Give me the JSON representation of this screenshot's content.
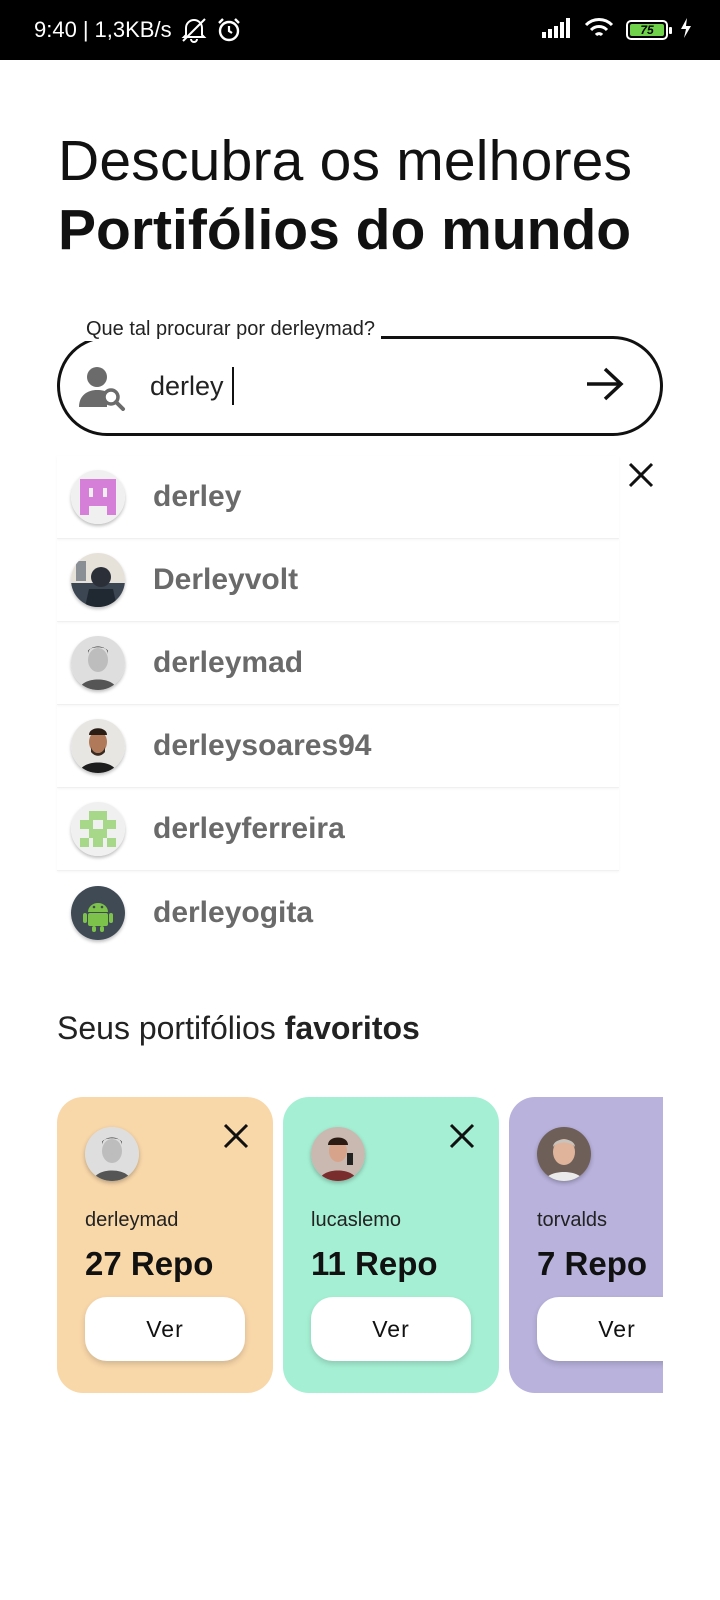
{
  "status_bar": {
    "time": "9:40",
    "speed": "1,3KB/s",
    "battery": "75",
    "icons": [
      "mute-icon",
      "alarm-icon",
      "signal-icon",
      "wifi-icon",
      "battery-icon",
      "charging-icon"
    ]
  },
  "headline": {
    "line1": "Descubra os melhores",
    "line2": "Portifólios do mundo"
  },
  "search": {
    "legend": "Que tal procurar por derleymad?",
    "value": "derley",
    "icon": "user-search-icon",
    "submit_icon": "arrow-right-icon"
  },
  "suggestions": {
    "close_icon": "close-icon",
    "items": [
      {
        "name": "derley",
        "avatar": "identicon-pink"
      },
      {
        "name": "Derleyvolt",
        "avatar": "photo"
      },
      {
        "name": "derleymad",
        "avatar": "photo"
      },
      {
        "name": "derleysoares94",
        "avatar": "photo"
      },
      {
        "name": "derleyferreira",
        "avatar": "identicon-green"
      },
      {
        "name": "derleyogita",
        "avatar": "android-icon"
      }
    ]
  },
  "favorites": {
    "title_regular": "Seus portifólios ",
    "title_bold": "favoritos",
    "cards": [
      {
        "user": "derleymad",
        "repos": "27 Repo",
        "button": "Ver",
        "color": "#F8D7A9"
      },
      {
        "user": "lucaslemo",
        "repos": "11 Repo",
        "button": "Ver",
        "color": "#A5EFD4"
      },
      {
        "user": "torvalds",
        "repos": "7 Repo",
        "button": "Ver",
        "color": "#B8B2DC"
      }
    ]
  }
}
